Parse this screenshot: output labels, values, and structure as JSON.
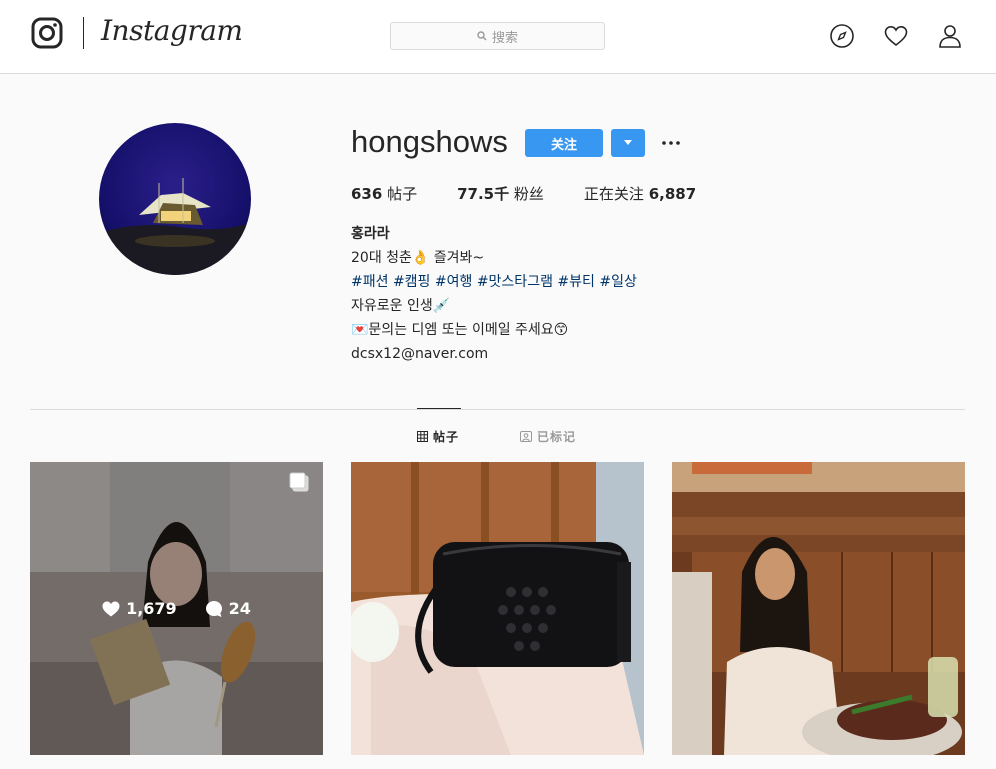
{
  "nav": {
    "wordmark": "Instagram",
    "search_placeholder": "搜索",
    "icons": [
      "camera-logo-icon",
      "compass-icon",
      "heart-icon",
      "person-icon"
    ]
  },
  "profile": {
    "username": "hongshows",
    "follow_label": "关注",
    "stats": {
      "posts_count": "636",
      "posts_label": "帖子",
      "followers_count": "77.5千",
      "followers_label": "粉丝",
      "following_label": "正在关注",
      "following_count": "6,887"
    },
    "bio": {
      "name": "홍라라",
      "line1": "20대 청춘👌 즐겨봐~",
      "line2": "#패션 #캠핑 #여행 #맛스타그램 #뷰티 #일상",
      "line3": "자유로운 인생💉",
      "line4": "💌문의는 디엠 또는 이메일 주세요😙",
      "line5": "dcsx12@naver.com"
    }
  },
  "tabs": {
    "posts_label": "帖子",
    "tagged_label": "已标记"
  },
  "posts": [
    {
      "likes": "1,679",
      "comments": "24",
      "hovered": true,
      "multi": true
    },
    {
      "hovered": false
    },
    {
      "hovered": false
    }
  ],
  "colors": {
    "accent": "#3897f0",
    "hashtag": "#003569"
  }
}
